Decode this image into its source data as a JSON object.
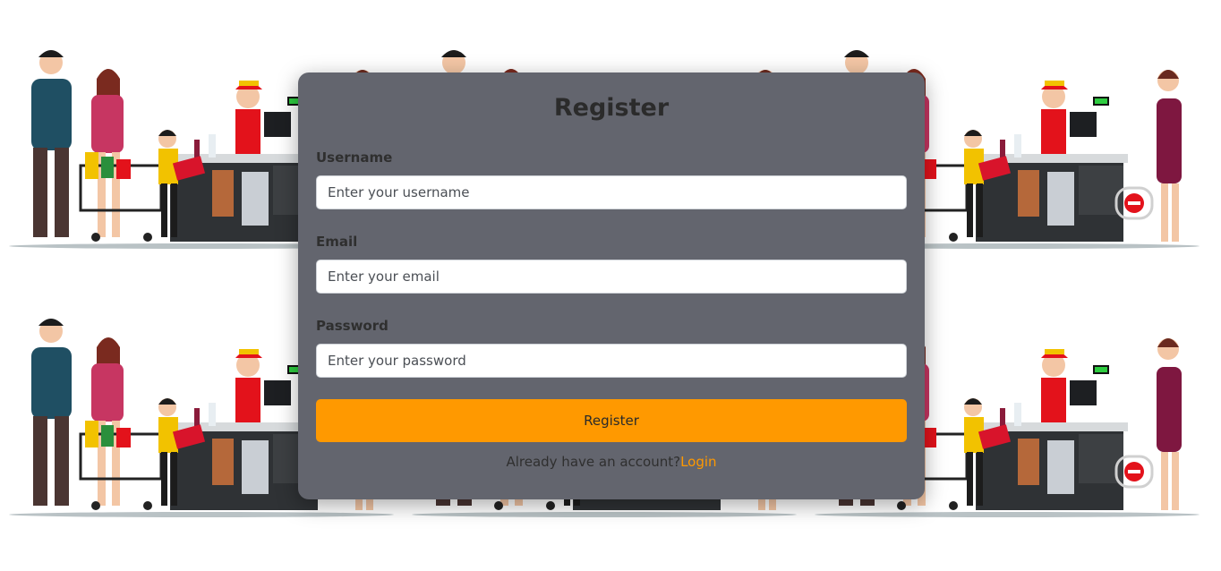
{
  "form": {
    "title": "Register",
    "username": {
      "label": "Username",
      "placeholder": "Enter your username",
      "value": ""
    },
    "email": {
      "label": "Email",
      "placeholder": "Enter your email",
      "value": ""
    },
    "password": {
      "label": "Password",
      "placeholder": "Enter your password",
      "value": ""
    },
    "submit_label": "Register",
    "footer_prompt": "Already have an account?",
    "login_link": "Login"
  },
  "colors": {
    "card_background": "#63656e",
    "accent": "#ff9900",
    "page_background": "#ffffff"
  },
  "background": {
    "illustration": "supermarket-checkout-scene"
  }
}
